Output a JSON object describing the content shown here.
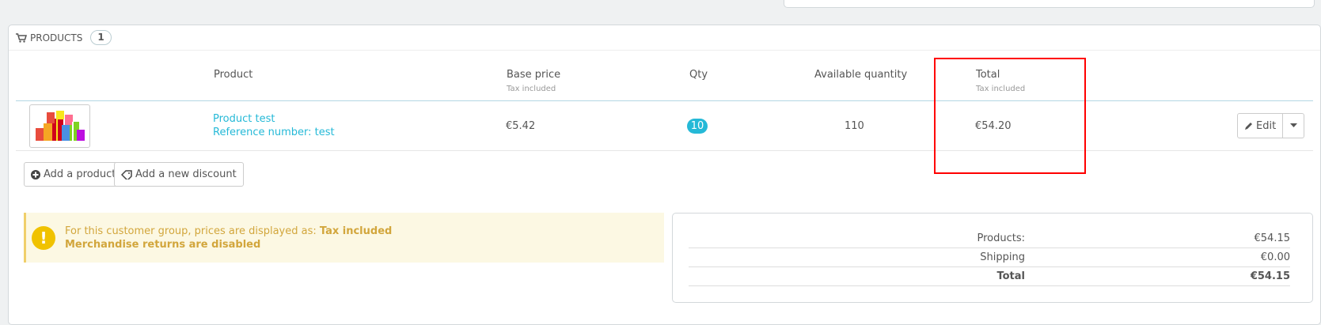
{
  "panel": {
    "title": "PRODUCTS",
    "count": "1"
  },
  "table": {
    "headers": {
      "product": "Product",
      "base_price": "Base price",
      "base_price_sub": "Tax included",
      "qty": "Qty",
      "available_qty": "Available quantity",
      "total": "Total",
      "total_sub": "Tax included"
    },
    "row": {
      "product_name": "Product test",
      "reference": "Reference number: test",
      "base_price": "€5.42",
      "qty": "10",
      "available_qty": "110",
      "total": "€54.20",
      "edit_label": "Edit"
    }
  },
  "actions": {
    "add_product": "Add a product",
    "add_discount": "Add a new discount"
  },
  "alert": {
    "prefix": "For this customer group, prices are displayed as: ",
    "tax_mode": "Tax included",
    "returns": "Merchandise returns are disabled"
  },
  "totals": {
    "products_label": "Products:",
    "products_value": "€54.15",
    "shipping_label": "Shipping",
    "shipping_value": "€0.00",
    "total_label": "Total",
    "total_value": "€54.15"
  },
  "colors": {
    "accent": "#25b9d7",
    "warning_bg": "#fcf8e3",
    "warning_text": "#d2a63c",
    "highlight": "#ff0000"
  }
}
